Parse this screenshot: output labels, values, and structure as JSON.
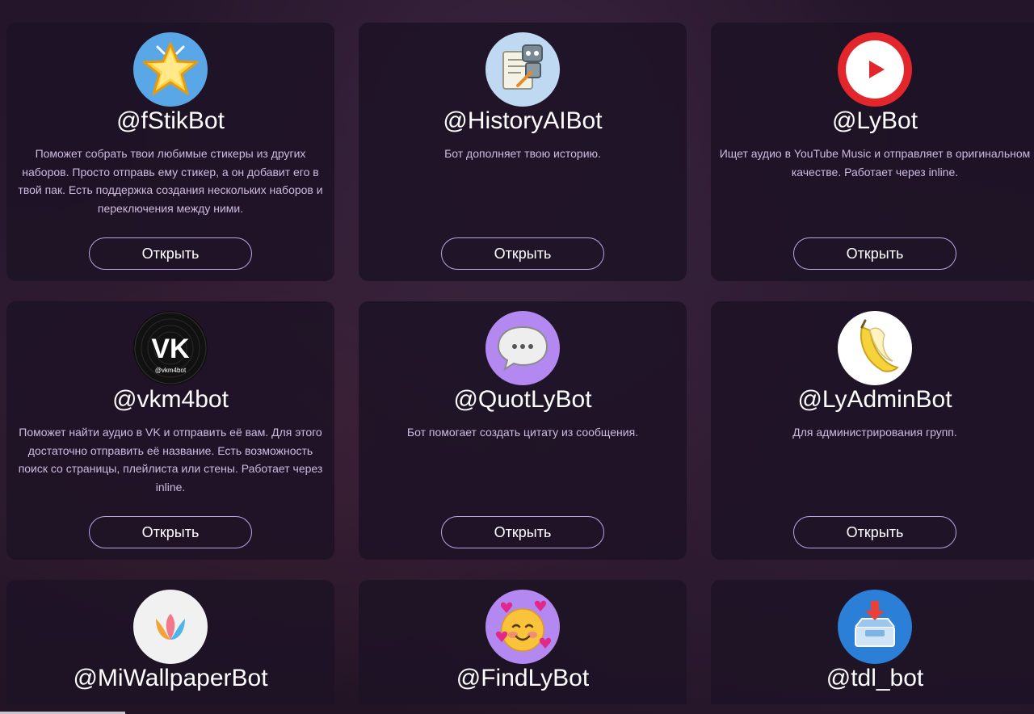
{
  "button_label": "Открыть",
  "bots": [
    {
      "name": "@fStikBot",
      "description": "Поможет собрать твои любимые стикеры из других наборов. Просто отправь ему стикер, а он добавит его в твой пак. Есть поддержка создания нескольких наборов и переключения между ними.",
      "icon": "star-sticker-icon"
    },
    {
      "name": "@HistoryAIBot",
      "description": "Бот дополняет твою историю.",
      "icon": "robot-writing-icon"
    },
    {
      "name": "@LyBot",
      "description": "Ищет аудио в YouTube Music и отправляет в оригинальном качестве. Работает через inline.",
      "icon": "youtube-play-icon"
    },
    {
      "name": "@vkm4bot",
      "description": "Поможет найти аудио в VK и отправить её вам. Для этого достаточно отправить её название. Есть возможность поиск со страницы, плейлиста или стены. Работает через inline.",
      "icon": "vk-vinyl-icon",
      "icon_caption": "@vkm4bot"
    },
    {
      "name": "@QuotLyBot",
      "description": "Бот помогает создать цитату из сообщения.",
      "icon": "speech-bubble-icon"
    },
    {
      "name": "@LyAdminBot",
      "description": "Для администрирования групп.",
      "icon": "banana-icon"
    },
    {
      "name": "@MiWallpaperBot",
      "description": "",
      "icon": "tulip-icon"
    },
    {
      "name": "@FindLyBot",
      "description": "",
      "icon": "smiling-face-hearts-icon"
    },
    {
      "name": "@tdl_bot",
      "description": "",
      "icon": "download-tray-icon"
    }
  ],
  "colors": {
    "accent_border": "#b9a6e4",
    "description_text": "#cdbbe0",
    "card_bg": "#1e1226"
  }
}
